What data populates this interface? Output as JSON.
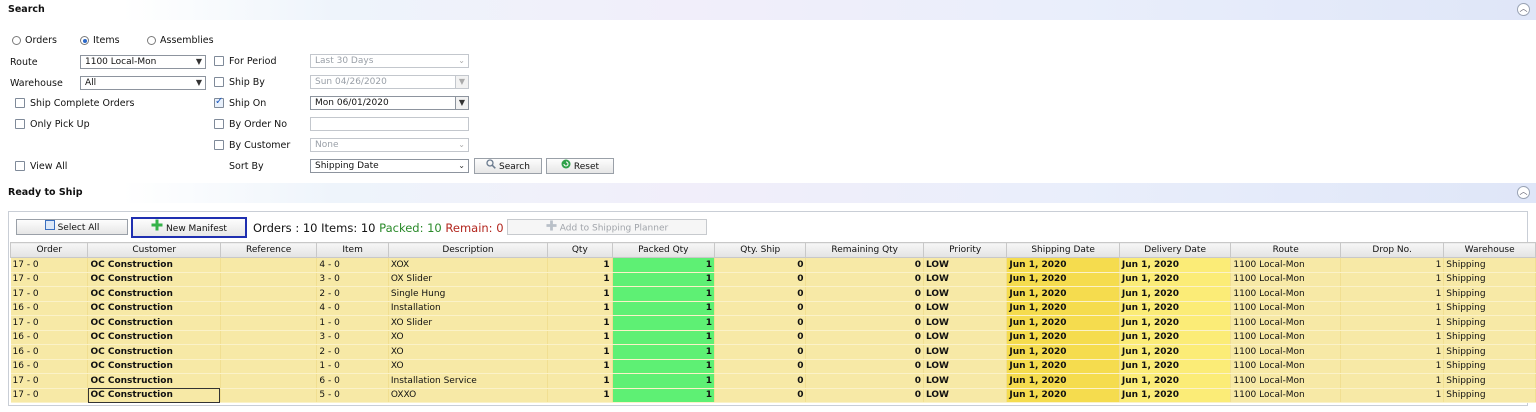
{
  "search_panel": {
    "title": "Search",
    "collapse_icon": "chevron-up-icon",
    "type_options": [
      "Orders",
      "Items",
      "Assemblies"
    ],
    "type_selected": "Items",
    "route_label": "Route",
    "route_value": "1100 Local-Mon",
    "warehouse_label": "Warehouse",
    "warehouse_value": "All",
    "ship_complete_label": "Ship Complete Orders",
    "only_pickup_label": "Only Pick Up",
    "view_all_label": "View All",
    "for_period_label": "For Period",
    "for_period_value": "Last 30 Days",
    "ship_by_label": "Ship By",
    "ship_by_value": "Sun 04/26/2020",
    "ship_on_label": "Ship On",
    "ship_on_checked": true,
    "ship_on_value": "Mon 06/01/2020",
    "by_order_label": "By Order No",
    "by_order_value": "",
    "by_customer_label": "By Customer",
    "by_customer_value": "None",
    "sort_by_label": "Sort By",
    "sort_by_value": "Shipping Date",
    "search_button": "Search",
    "reset_button": "Reset"
  },
  "ready_panel": {
    "title": "Ready to Ship",
    "select_all_button": "Select All",
    "new_manifest_button": "New Manifest",
    "summary": {
      "orders_label": "Orders : 10",
      "items_label": "Items: 10",
      "packed_label": "Packed: 10",
      "remain_label": "Remain: 0"
    },
    "add_planner_button": "Add to Shipping Planner",
    "colors": {
      "packed": "#2a8a2a",
      "remain": "#b3261e",
      "highlight_border": "#1f2fb0",
      "packed_cell": "#5ef074"
    }
  },
  "grid": {
    "columns": [
      "Order",
      "Customer",
      "Reference",
      "Item",
      "Description",
      "Qty",
      "Packed Qty",
      "Qty. Ship",
      "Remaining Qty",
      "Priority",
      "Shipping Date",
      "Delivery Date",
      "Route",
      "Drop No.",
      "Warehouse"
    ],
    "rows": [
      {
        "order": "17 - 0",
        "customer": "OC Construction",
        "reference": "",
        "item": "4 - 0",
        "description": "XOX",
        "qty": "1",
        "packed": "1",
        "ship": "0",
        "remaining": "0",
        "priority": "LOW",
        "ship_date": "Jun 1, 2020",
        "delivery": "Jun 1, 2020",
        "route": "1100 Local-Mon",
        "drop": "1",
        "warehouse": "Shipping"
      },
      {
        "order": "17 - 0",
        "customer": "OC Construction",
        "reference": "",
        "item": "3 - 0",
        "description": "OX Slider",
        "qty": "1",
        "packed": "1",
        "ship": "0",
        "remaining": "0",
        "priority": "LOW",
        "ship_date": "Jun 1, 2020",
        "delivery": "Jun 1, 2020",
        "route": "1100 Local-Mon",
        "drop": "1",
        "warehouse": "Shipping"
      },
      {
        "order": "17 - 0",
        "customer": "OC Construction",
        "reference": "",
        "item": "2 - 0",
        "description": "Single Hung",
        "qty": "1",
        "packed": "1",
        "ship": "0",
        "remaining": "0",
        "priority": "LOW",
        "ship_date": "Jun 1, 2020",
        "delivery": "Jun 1, 2020",
        "route": "1100 Local-Mon",
        "drop": "1",
        "warehouse": "Shipping"
      },
      {
        "order": "16 - 0",
        "customer": "OC Construction",
        "reference": "",
        "item": "4 - 0",
        "description": "Installation",
        "qty": "1",
        "packed": "1",
        "ship": "0",
        "remaining": "0",
        "priority": "LOW",
        "ship_date": "Jun 1, 2020",
        "delivery": "Jun 1, 2020",
        "route": "1100 Local-Mon",
        "drop": "1",
        "warehouse": "Shipping"
      },
      {
        "order": "17 - 0",
        "customer": "OC Construction",
        "reference": "",
        "item": "1 - 0",
        "description": "XO Slider",
        "qty": "1",
        "packed": "1",
        "ship": "0",
        "remaining": "0",
        "priority": "LOW",
        "ship_date": "Jun 1, 2020",
        "delivery": "Jun 1, 2020",
        "route": "1100 Local-Mon",
        "drop": "1",
        "warehouse": "Shipping"
      },
      {
        "order": "16 - 0",
        "customer": "OC Construction",
        "reference": "",
        "item": "3 - 0",
        "description": "XO",
        "qty": "1",
        "packed": "1",
        "ship": "0",
        "remaining": "0",
        "priority": "LOW",
        "ship_date": "Jun 1, 2020",
        "delivery": "Jun 1, 2020",
        "route": "1100 Local-Mon",
        "drop": "1",
        "warehouse": "Shipping"
      },
      {
        "order": "16 - 0",
        "customer": "OC Construction",
        "reference": "",
        "item": "2 - 0",
        "description": "XO",
        "qty": "1",
        "packed": "1",
        "ship": "0",
        "remaining": "0",
        "priority": "LOW",
        "ship_date": "Jun 1, 2020",
        "delivery": "Jun 1, 2020",
        "route": "1100 Local-Mon",
        "drop": "1",
        "warehouse": "Shipping"
      },
      {
        "order": "16 - 0",
        "customer": "OC Construction",
        "reference": "",
        "item": "1 - 0",
        "description": "XO",
        "qty": "1",
        "packed": "1",
        "ship": "0",
        "remaining": "0",
        "priority": "LOW",
        "ship_date": "Jun 1, 2020",
        "delivery": "Jun 1, 2020",
        "route": "1100 Local-Mon",
        "drop": "1",
        "warehouse": "Shipping"
      },
      {
        "order": "17 - 0",
        "customer": "OC Construction",
        "reference": "",
        "item": "6 - 0",
        "description": "Installation Service",
        "qty": "1",
        "packed": "1",
        "ship": "0",
        "remaining": "0",
        "priority": "LOW",
        "ship_date": "Jun 1, 2020",
        "delivery": "Jun 1, 2020",
        "route": "1100 Local-Mon",
        "drop": "1",
        "warehouse": "Shipping"
      },
      {
        "order": "17 - 0",
        "customer": "OC Construction",
        "reference": "",
        "item": "5 - 0",
        "description": "OXXO",
        "qty": "1",
        "packed": "1",
        "ship": "0",
        "remaining": "0",
        "priority": "LOW",
        "ship_date": "Jun 1, 2020",
        "delivery": "Jun 1, 2020",
        "route": "1100 Local-Mon",
        "drop": "1",
        "warehouse": "Shipping"
      }
    ]
  }
}
